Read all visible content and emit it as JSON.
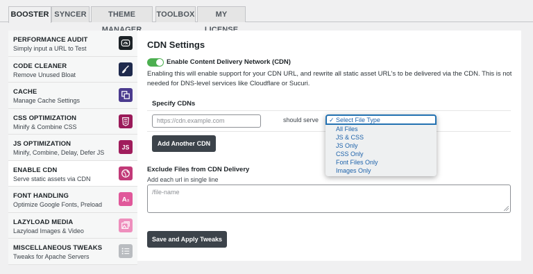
{
  "tabs": [
    "BOOSTER",
    "SYNCER",
    "THEME MANAGER",
    "TOOLBOX",
    "MY LICENSE"
  ],
  "sidebar": [
    {
      "title": "PERFORMANCE AUDIT",
      "sub": "Simply input a URL to Test",
      "icon": "gauge-icon",
      "color": "#1d2327"
    },
    {
      "title": "CODE CLEANER",
      "sub": "Remove Unused Bloat",
      "icon": "broom-icon",
      "color": "#1f2a4d"
    },
    {
      "title": "CACHE",
      "sub": "Manage Cache Settings",
      "icon": "copy-icon",
      "color": "#4b3b8f"
    },
    {
      "title": "CSS OPTIMIZATION",
      "sub": "Minify & Combine CSS",
      "icon": "css3-icon",
      "color": "#9b1b5a"
    },
    {
      "title": "JS OPTIMIZATION",
      "sub": "Minify, Combine, Delay, Defer JS",
      "icon": "js-icon",
      "color": "#a01d5c"
    },
    {
      "title": "ENABLE CDN",
      "sub": "Serve static assets via CDN",
      "icon": "globe-icon",
      "color": "#c23a78"
    },
    {
      "title": "FONT HANDLING",
      "sub": "Optimize Google Fonts, Preload",
      "icon": "font-icon",
      "color": "#e0589a"
    },
    {
      "title": "LAZYLOAD MEDIA",
      "sub": "Lazyload Images & Video",
      "icon": "image-icon",
      "color": "#ee8fbd"
    },
    {
      "title": "MISCELLANEOUS TWEAKS",
      "sub": "Tweaks for Apache Servers",
      "icon": "list-icon",
      "color": "#b9bcc0"
    }
  ],
  "main": {
    "title": "CDN Settings",
    "toggle_label": "Enable Content Delivery Network (CDN)",
    "description": "Enabling this will enable support for your CDN URL, and rewrite all static asset URL's to be delivered via the CDN. This is not needed for DNS-level services like Cloudflare or Sucuri.",
    "specify_title": "Specify CDNs",
    "cdn_placeholder": "https://cdn.example.com",
    "should_serve": "should serve",
    "add_button": "Add Another CDN",
    "exclude_title": "Exclude Files from CDN Delivery",
    "exclude_hint": "Add each url in single line",
    "exclude_placeholder": "/file-name",
    "save_button": "Save and Apply Tweaks"
  },
  "dropdown": {
    "selected": "✓ Select File Type",
    "options": [
      "All Files",
      "JS & CSS",
      "JS Only",
      "CSS Only",
      "Font Files Only",
      "Images Only"
    ]
  }
}
